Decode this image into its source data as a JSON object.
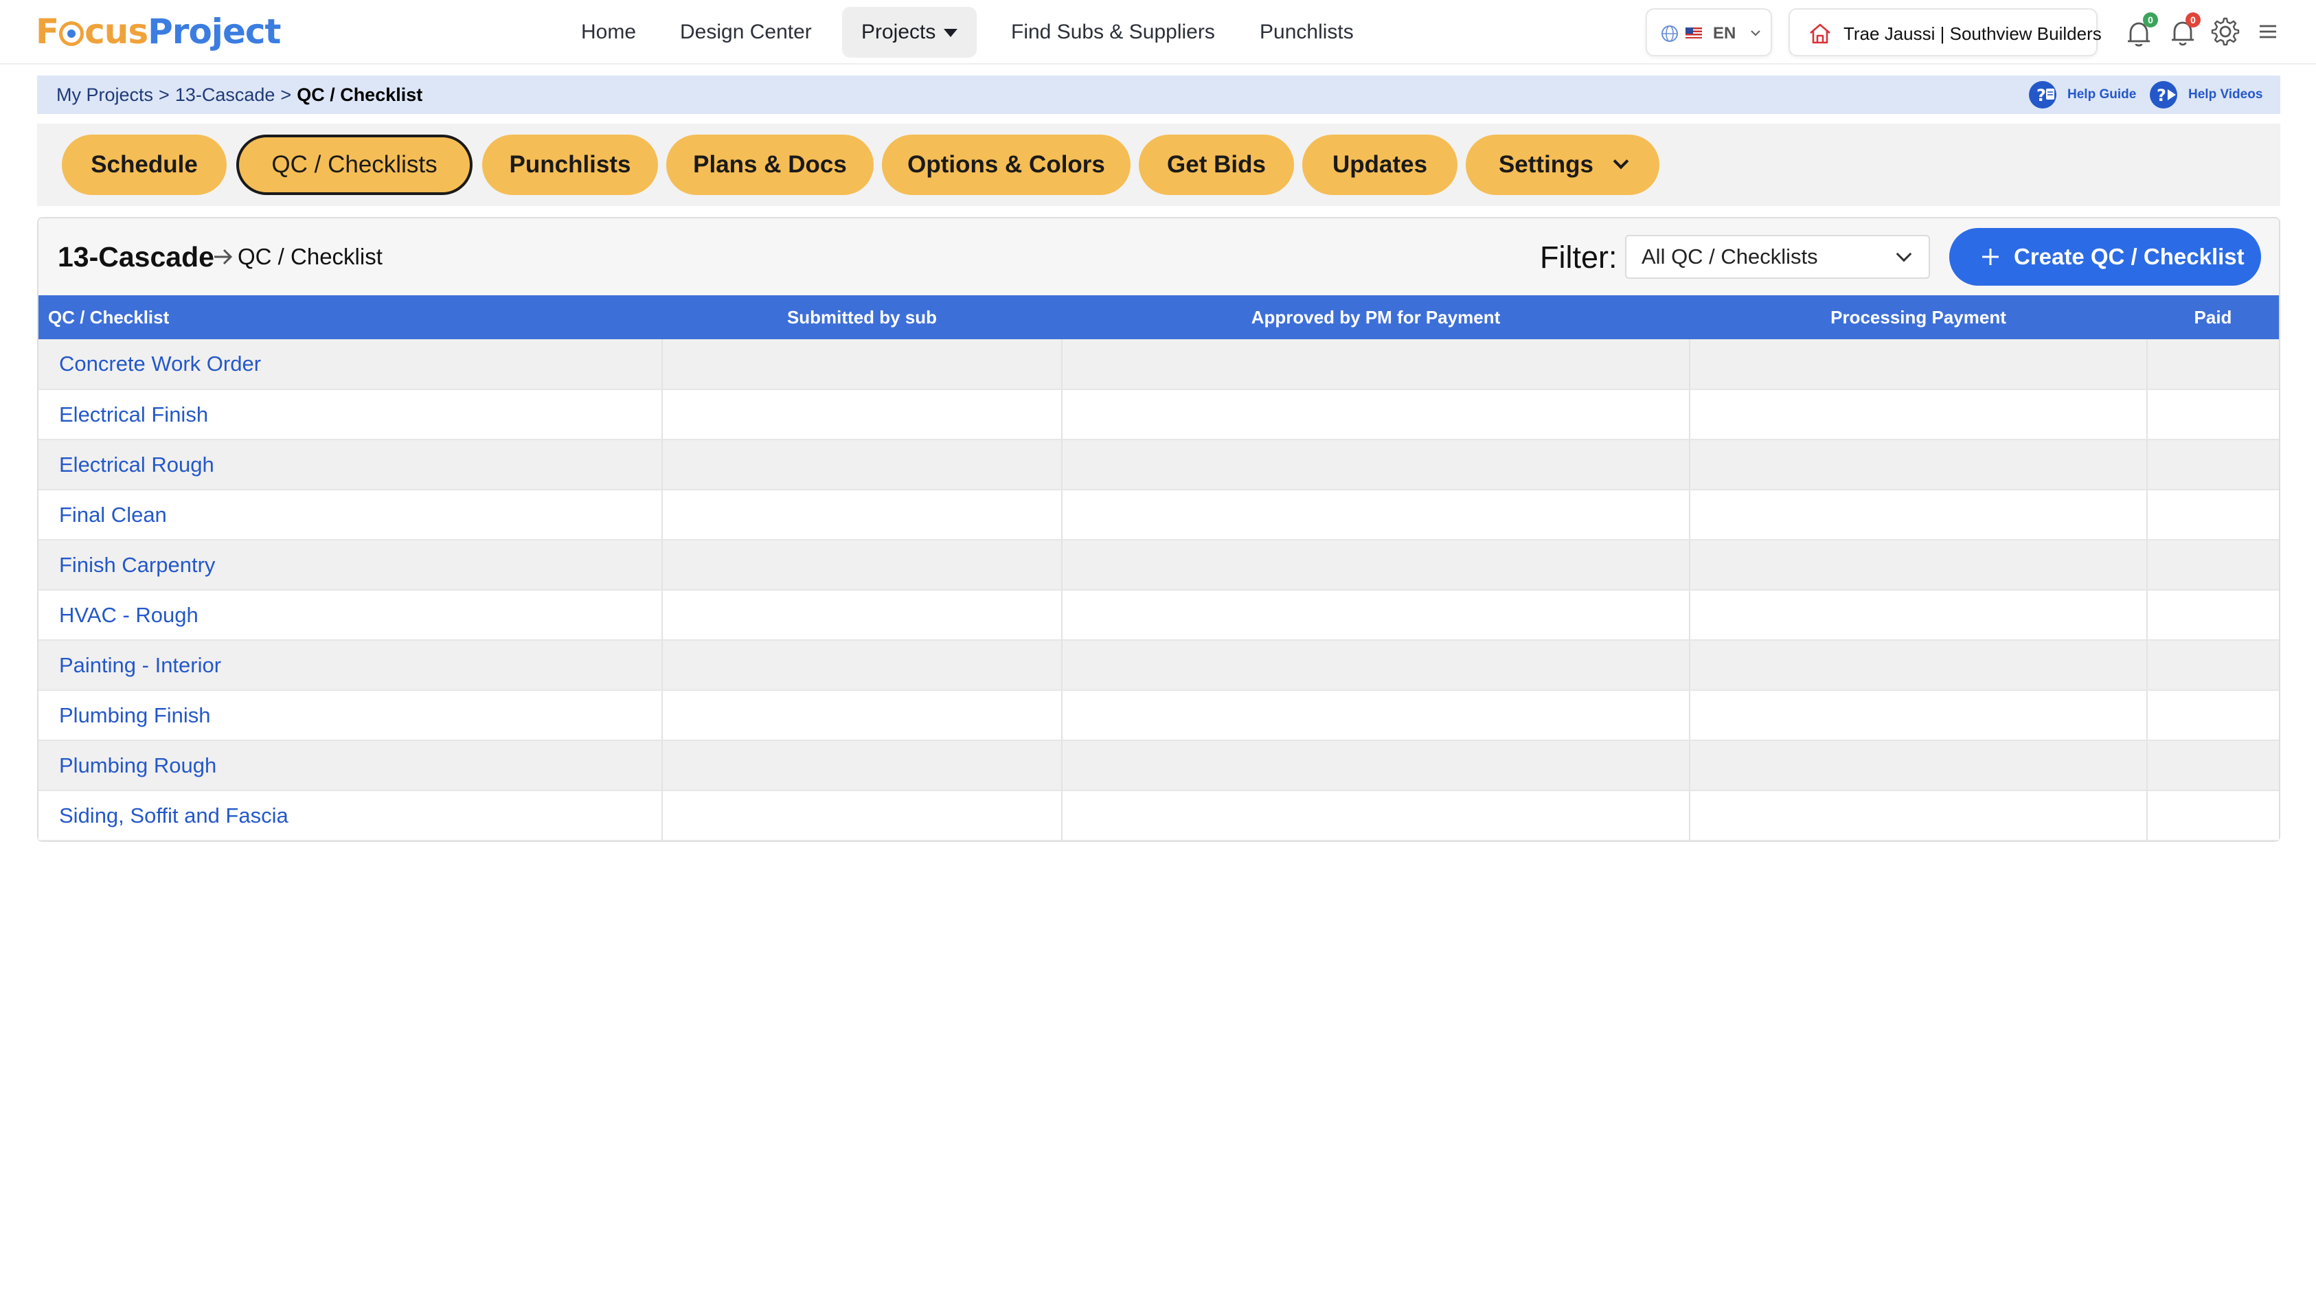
{
  "colors": {
    "brand_orange": "#f0a23a",
    "brand_blue": "#3b7de0",
    "pill": "#f5bd55",
    "table_header": "#3d6fd8",
    "primary_button": "#2c6be6",
    "link": "#2458c9",
    "breadcrumb_bg": "#dde6f7",
    "badge_green": "#3aa45b",
    "badge_red": "#e0453a"
  },
  "logo": {
    "part1": "F",
    "part2": "cus",
    "part3": "Project"
  },
  "nav": {
    "home": "Home",
    "design_center": "Design Center",
    "projects": "Projects",
    "find_subs": "Find Subs & Suppliers",
    "punchlists": "Punchlists"
  },
  "language": {
    "code": "EN",
    "icons": [
      "globe-icon",
      "us-flag-icon",
      "chevron-down-icon"
    ]
  },
  "user": {
    "name": "Trae Jaussi | Southview Builders",
    "icon": "house-icon"
  },
  "notifications": {
    "team_count": "0",
    "alerts_count": "0"
  },
  "breadcrumb": {
    "level1": "My Projects",
    "sep": ">",
    "level2": "13-Cascade",
    "current": "QC / Checklist"
  },
  "help": {
    "guide": "Help Guide",
    "videos": "Help Videos"
  },
  "tabs": {
    "schedule": "Schedule",
    "qc": "QC / Checklists",
    "punchlists": "Punchlists",
    "plans": "Plans & Docs",
    "options": "Options & Colors",
    "bids": "Get Bids",
    "updates": "Updates",
    "settings": "Settings",
    "active": "QC / Checklists"
  },
  "panel": {
    "project": "13-Cascade",
    "subtitle": "QC / Checklist",
    "filter_label": "Filter:",
    "filter_value": "All QC / Checklists",
    "create_label": "Create QC / Checklist"
  },
  "table": {
    "headers": {
      "checklist": "QC / Checklist",
      "submitted": "Submitted by sub",
      "approved": "Approved by PM for Payment",
      "processing": "Processing Payment",
      "paid": "Paid"
    },
    "rows": [
      "Concrete Work Order",
      "Electrical Finish",
      "Electrical Rough",
      "Final Clean",
      "Finish Carpentry",
      "HVAC - Rough",
      "Painting - Interior",
      "Plumbing Finish",
      "Plumbing Rough",
      "Siding, Soffit and Fascia"
    ]
  }
}
